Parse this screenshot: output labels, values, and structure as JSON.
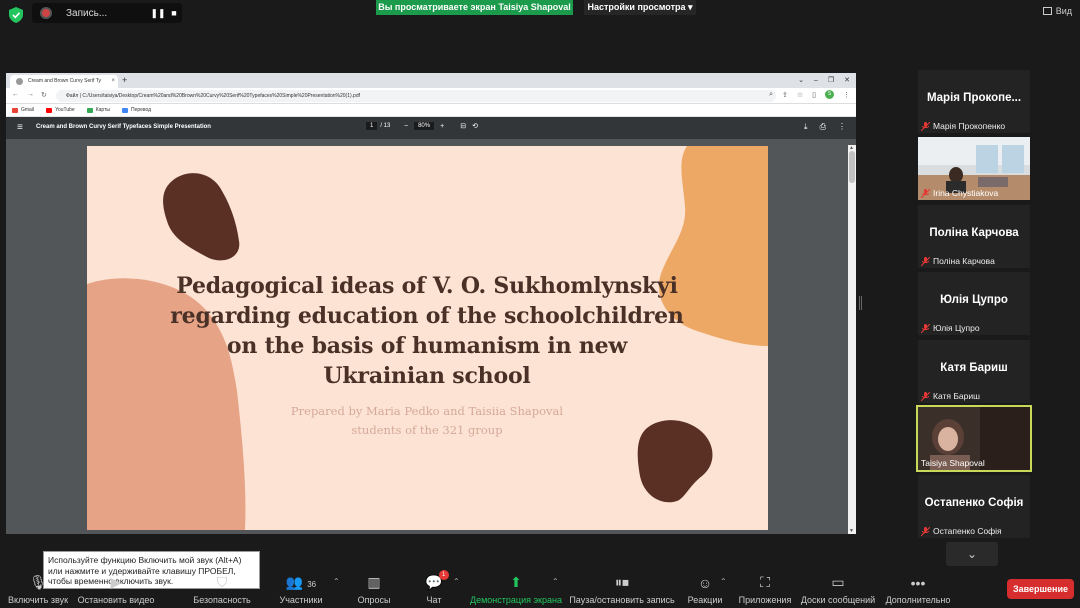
{
  "recording": {
    "label": "Запись...",
    "pause": "❚❚",
    "stop": "■"
  },
  "banner": {
    "sharing": "Вы просматриваете экран Taisiya Shapoval",
    "view_settings": "Настройки просмотра ▾",
    "view": "Вид"
  },
  "browser": {
    "tab_title": "Cream and Brown Curvy Serif Ty",
    "tab_close": "×",
    "new_tab": "+",
    "url": "Файл  |  C:/Users/taisiya/Desktop/Cream%20and%20Brown%20Curvy%20Serif%20Typefaces%20Simple%20Presentation%20(1).pdf",
    "bookmarks": [
      "Gmail",
      "YouTube",
      "Карты",
      "Перевод"
    ],
    "profile_initial": "S"
  },
  "pdf": {
    "title": "Cream and Brown Curvy Serif Typefaces Simple Presentation",
    "page_current": "1",
    "page_total": "/ 13",
    "zoom": "80%"
  },
  "slide": {
    "title": "Pedagogical ideas of V. O. Sukhomlynskyi regarding education of the schoolchildren on the basis of humanism in new Ukrainian school",
    "subtitle_line1": "Prepared by Maria Pedko and Taisiia Shapoval",
    "subtitle_line2": "students of the 321 group"
  },
  "participants": [
    {
      "display": "Марія Прокопе...",
      "name": "Марія Прокопенко",
      "video": false
    },
    {
      "display": "",
      "name": "Irina Chystiakova",
      "video": true
    },
    {
      "display": "Поліна Карчова",
      "name": "Поліна Карчова",
      "video": false
    },
    {
      "display": "Юлія Цупро",
      "name": "Юлія Цупро",
      "video": false
    },
    {
      "display": "Катя Бариш",
      "name": "Катя Бариш",
      "video": false
    },
    {
      "display": "",
      "name": "Taisiya Shapoval",
      "video": true
    },
    {
      "display": "Остапенко Софія",
      "name": "Остапенко Софія",
      "video": false
    }
  ],
  "tooltip": "Используйте функцию Включить мой звук (Alt+A) или нажмите и удерживайте клавишу ПРОБЕЛ, чтобы временно включить звук.",
  "toolbar": {
    "unmute": "Включить звук",
    "stop_video": "Остановить видео",
    "security": "Безопасность",
    "participants": "Участники",
    "participants_count": "36",
    "polls": "Опросы",
    "chat": "Чат",
    "chat_badge": "1",
    "share_screen": "Демонстрация экрана",
    "pause_recording": "Пауза/остановить запись",
    "reactions": "Реакции",
    "apps": "Приложения",
    "whiteboards": "Доски сообщений",
    "more": "Дополнительно",
    "end": "Завершение"
  },
  "colors": {
    "accent_green": "#1b9b4b",
    "end_red": "#d62e2e",
    "slide_bg": "#fde3d3",
    "slide_title": "#4a3127"
  }
}
